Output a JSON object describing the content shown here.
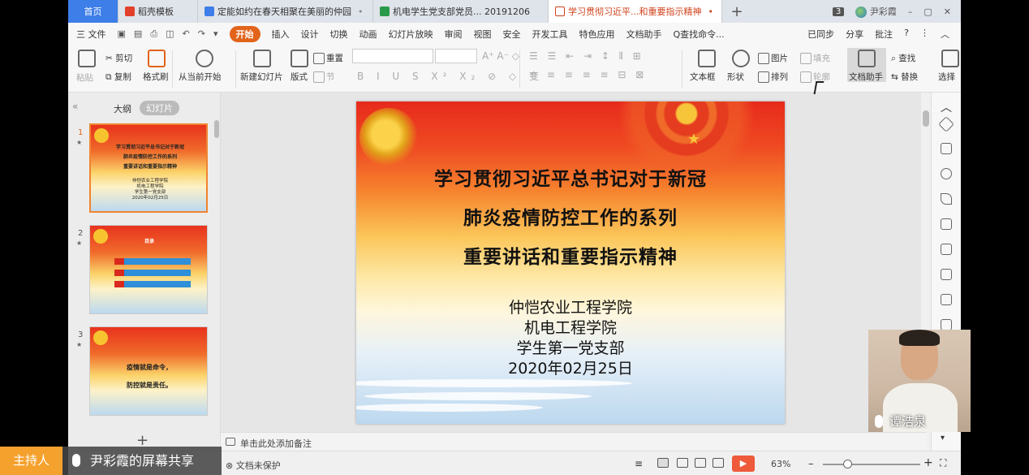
{
  "tabs": {
    "home": "首页",
    "t1": "稻壳模板",
    "t2": "定能如约在春天相聚在美丽的仲园",
    "t3": "机电学生党支部党员... 20191206",
    "t4": "学习贯彻习近平...和重要指示精神",
    "count": "3",
    "user": "尹彩霞"
  },
  "menu": {
    "file": "三 文件",
    "start": "开始",
    "items": [
      "插入",
      "设计",
      "切换",
      "动画",
      "幻灯片放映",
      "审阅",
      "视图",
      "安全",
      "开发工具",
      "特色应用",
      "文档助手"
    ],
    "search": "Q查找命令...",
    "sync": "已同步",
    "share": "分享",
    "comment": "批注"
  },
  "ribbon": {
    "paste": "粘贴",
    "cut": "剪切",
    "copy": "复制",
    "format_painter": "格式刷",
    "from_current": "从当前开始",
    "new_slide": "新建幻灯片",
    "layout": "版式",
    "reset": "重置",
    "section": "节",
    "text_box": "文本框",
    "shape": "形状",
    "picture": "图片",
    "arrange": "排列",
    "fill": "填充",
    "outline": "轮廓",
    "doc_helper": "文档助手",
    "find": "查找",
    "replace": "替换",
    "select": "选择"
  },
  "left_pane": {
    "outline_tab": "大纲",
    "slides_tab": "幻灯片",
    "collapse": "«",
    "add": "+"
  },
  "thumbs": {
    "n1": "1",
    "n2": "2",
    "n3": "3",
    "s1_title1": "学习贯彻习近平总书记对于新冠",
    "s1_title2": "肺炎疫情防控工作的系列",
    "s1_title3": "重要讲话和重要指示精神",
    "s1_sub1": "仲恺农业工程学院",
    "s1_sub2": "机电工程学院",
    "s1_sub3": "学生第一党支部",
    "s1_sub4": "2020年02月25日",
    "s2_title": "目录",
    "s3_line1": "疫情就是命令，",
    "s3_line2": "防控就是责任。"
  },
  "slide": {
    "title1": "学习贯彻习近平总书记对于新冠",
    "title2": "肺炎疫情防控工作的系列",
    "title3": "重要讲话和重要指示精神",
    "org1": "仲恺农业工程学院",
    "org2": "机电工程学院",
    "org3": "学生第一党支部",
    "date": "2020年02月25日"
  },
  "notes_placeholder": "单击此处添加备注",
  "status": {
    "protect": "文档未保护",
    "zoom": "63%"
  },
  "overlay": {
    "host": "主持人",
    "share": "尹彩霞的屏幕共享",
    "cam_name": "谭浩泉"
  },
  "colors": {
    "accent": "#e2641b",
    "home_tab": "#3d7ee8",
    "play": "#ee5a3a"
  }
}
